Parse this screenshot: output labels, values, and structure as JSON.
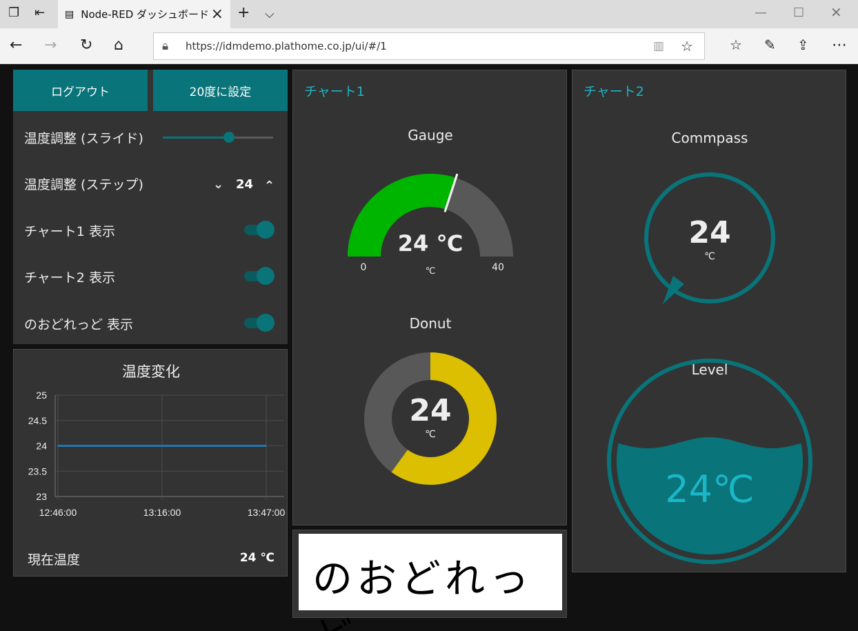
{
  "browser": {
    "tab_title": "Node-RED ダッシュボード",
    "url": "https://idmdemo.plathome.co.jp/ui/#/1"
  },
  "controls": {
    "logout_label": "ログアウト",
    "set20_label": "20度に設定",
    "slider_label": "温度調整 (スライド)",
    "slider_value_fraction": 0.6,
    "stepper_label": "温度調整 (ステップ)",
    "stepper_value": "24",
    "toggles": [
      {
        "label": "チャート1 表示",
        "on": true
      },
      {
        "label": "チャート2 表示",
        "on": true
      },
      {
        "label": "のおどれっど 表示",
        "on": true
      }
    ]
  },
  "history": {
    "title": "温度変化",
    "current_label": "現在温度",
    "current_value": "24 ℃"
  },
  "chart_data": {
    "type": "line",
    "title": "温度変化",
    "x": [
      "12:46:00",
      "13:16:00",
      "13:47:00"
    ],
    "y_ticks": [
      "25",
      "24.5",
      "24",
      "23.5",
      "23"
    ],
    "ylim": [
      23,
      25
    ],
    "series": [
      {
        "values": [
          24,
          24,
          24
        ],
        "color": "#1f77b4"
      }
    ],
    "grid": true
  },
  "chart1": {
    "title": "チャート1",
    "gauge": {
      "label": "Gauge",
      "value_text": "24 ℃",
      "unit": "℃",
      "min": "0",
      "max": "40",
      "value": 24,
      "min_value": 0,
      "max_value": 40
    },
    "donut": {
      "label": "Donut",
      "value_text": "24",
      "unit": "℃",
      "value": 24,
      "min_value": 0,
      "max_value": 40
    }
  },
  "chart2": {
    "title": "チャート2",
    "compass": {
      "label": "Commpass",
      "value_text": "24",
      "unit": "℃"
    },
    "level": {
      "label": "Level",
      "value_text": "24℃",
      "fill_fraction": 0.6
    }
  },
  "logo": {
    "text": "のおどれっど"
  },
  "colors": {
    "accent": "#097479",
    "title": "#1bb6c8",
    "gauge_fill": "#00b500",
    "donut_fill": "#dcbf00",
    "card_bg": "#333333",
    "page_bg": "#111111"
  }
}
